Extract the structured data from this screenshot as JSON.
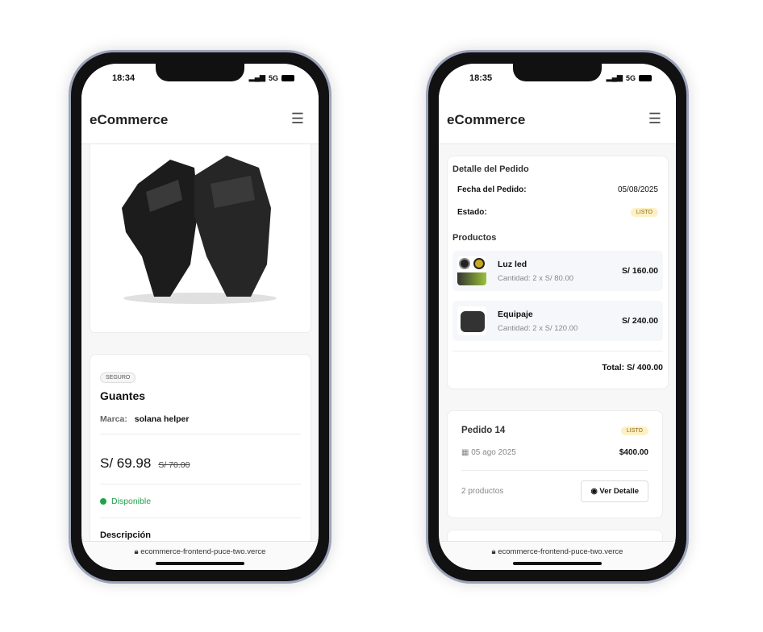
{
  "left": {
    "time": "18:34",
    "network": "5G",
    "app_title": "eCommerce",
    "product": {
      "badge": "SEGURO",
      "name": "Guantes",
      "brand_label": "Marca:",
      "brand": "solana helper",
      "price": "S/ 69.98",
      "old_price": "S/ 70.00",
      "availability": "Disponible",
      "description_label": "Descripción"
    },
    "url": "ecommerce-frontend-puce-two.verce"
  },
  "right": {
    "time": "18:35",
    "network": "5G",
    "app_title": "eCommerce",
    "detail": {
      "title": "Detalle del Pedido",
      "date_label": "Fecha del Pedido:",
      "date": "05/08/2025",
      "status_label": "Estado:",
      "status": "LISTO",
      "products_label": "Productos",
      "products": [
        {
          "name": "Luz led",
          "qty": "Cantidad: 2 x S/ 80.00",
          "total": "S/ 160.00"
        },
        {
          "name": "Equipaje",
          "qty": "Cantidad: 2 x S/ 120.00",
          "total": "S/ 240.00"
        }
      ],
      "total": "Total: S/ 400.00"
    },
    "order": {
      "title": "Pedido 14",
      "status": "LISTO",
      "date": "05 ago 2025",
      "amount": "$400.00",
      "count": "2 productos",
      "button": "Ver Detalle"
    },
    "url": "ecommerce-frontend-puce-two.verce"
  },
  "colors": {
    "available": "#22a04b",
    "status_bg": "#fdf0c4"
  }
}
